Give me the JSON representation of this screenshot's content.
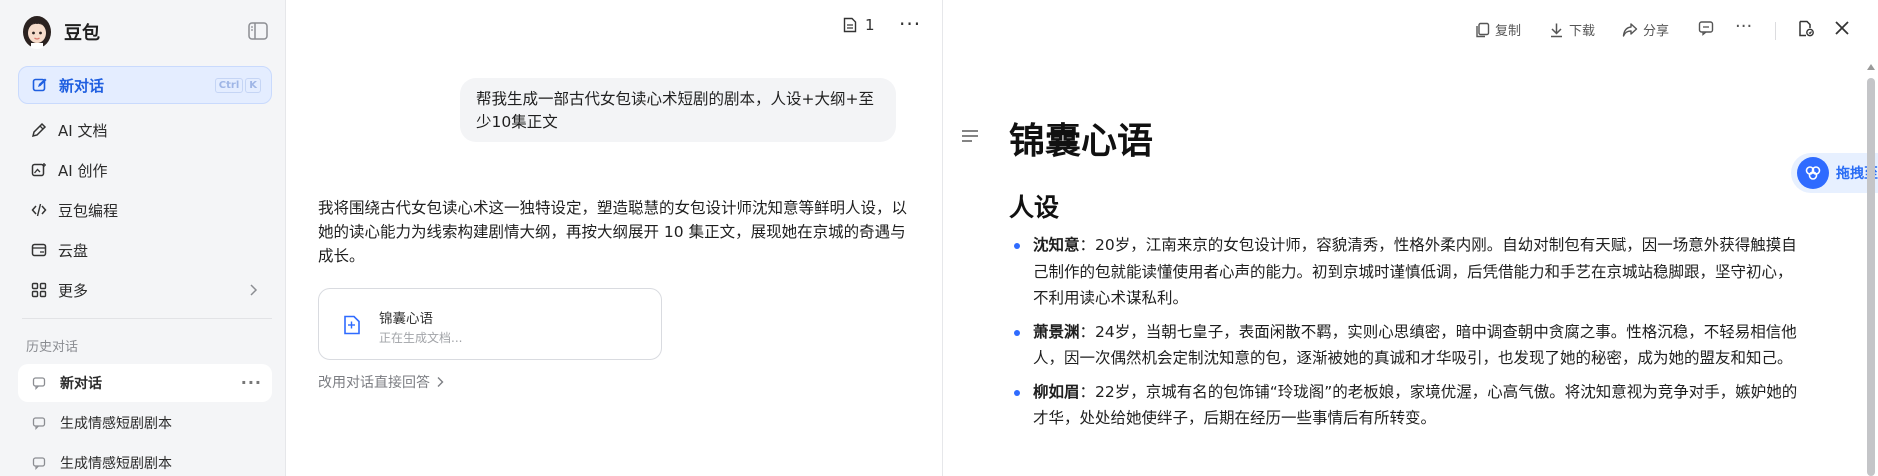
{
  "sidebar": {
    "brand_name": "豆包",
    "nav": [
      {
        "label": "新对话",
        "icon": "edit-icon",
        "shortcut": [
          "Ctrl",
          "K"
        ]
      },
      {
        "label": "AI 文档",
        "icon": "pen-icon"
      },
      {
        "label": "AI 创作",
        "icon": "image-create-icon"
      },
      {
        "label": "豆包编程",
        "icon": "code-icon"
      },
      {
        "label": "云盘",
        "icon": "cloud-drive-icon"
      },
      {
        "label": "更多",
        "icon": "grid-icon"
      }
    ],
    "history_label": "历史对话",
    "history": [
      {
        "label": "新对话"
      },
      {
        "label": "生成情感短剧剧本"
      },
      {
        "label": "生成情感短剧剧本"
      }
    ],
    "more_glyph": "···"
  },
  "chat": {
    "doc_count": "1",
    "more_glyph": "···",
    "user_message": "帮我生成一部古代女包读心术短剧的剧本，人设+大纲+至少10集正文",
    "assistant_message": "我将围绕古代女包读心术这一独特设定，塑造聪慧的女包设计师沈知意等鲜明人设，以她的读心能力为线索构建剧情大纲，再按大纲展开 10 集正文，展现她在京城的奇遇与成长。",
    "doc_card": {
      "title": "锦囊心语",
      "status": "正在生成文档..."
    },
    "switch_link": "改用对话直接回答"
  },
  "doc_panel": {
    "toolbar": {
      "copy": "复制",
      "download": "下载",
      "share": "分享",
      "more_glyph": "···"
    },
    "title": "锦囊心语",
    "section": "人设",
    "characters": [
      {
        "name": "沈知意",
        "desc": "：20岁，江南来京的女包设计师，容貌清秀，性格外柔内刚。自幼对制包有天赋，因一场意外获得触摸自己制作的包就能读懂使用者心声的能力。初到京城时谨慎低调，后凭借能力和手艺在京城站稳脚跟，坚守初心，不利用读心术谋私利。"
      },
      {
        "name": "萧景渊",
        "desc": "：24岁，当朝七皇子，表面闲散不羁，实则心思缜密，暗中调查朝中贪腐之事。性格沉稳，不轻易相信他人，因一次偶然机会定制沈知意的包，逐渐被她的真诚和才华吸引，也发现了她的秘密，成为她的盟友和知己。"
      },
      {
        "name": "柳如眉",
        "desc": "：22岁，京城有名的包饰铺“玲珑阁”的老板娘，家境优渥，心高气傲。将沈知意视为竞争对手，嫉妒她的才华，处处给她使绊子，后期在经历一些事情后有所转变。"
      }
    ],
    "drag_label": "拖拽至此"
  }
}
